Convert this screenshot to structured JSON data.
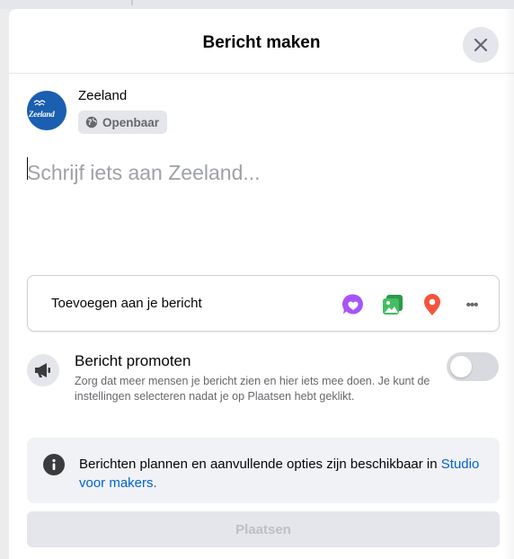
{
  "dialog": {
    "title": "Bericht maken"
  },
  "author": {
    "name": "Zeeland",
    "avatar_text": "Zeeland",
    "audience": "Openbaar"
  },
  "composer": {
    "placeholder": "Schrijf iets aan Zeeland..."
  },
  "add_to_post": {
    "label": "Toevoegen aan je bericht",
    "icons": [
      {
        "name": "feeling-icon",
        "color": "#a855f7"
      },
      {
        "name": "photo-video-icon",
        "color": "#45bd62"
      },
      {
        "name": "location-pin-icon",
        "color": "#f5533d"
      },
      {
        "name": "more-icon",
        "text": "•••",
        "color": "#65676b"
      }
    ]
  },
  "promote": {
    "title": "Bericht promoten",
    "description": "Zorg dat meer mensen je bericht zien en hier iets mee doen. Je kunt de instellingen selecteren nadat je op Plaatsen hebt geklikt.",
    "enabled": false
  },
  "info": {
    "text": "Berichten plannen en aanvullende opties zijn beschikbaar in ",
    "link": "Studio voor makers."
  },
  "post_button": {
    "label": "Plaatsen",
    "disabled": true
  },
  "colors": {
    "accent": "#0064d1",
    "avatar": "#1a5fb0",
    "surface": "#e4e6eb"
  }
}
